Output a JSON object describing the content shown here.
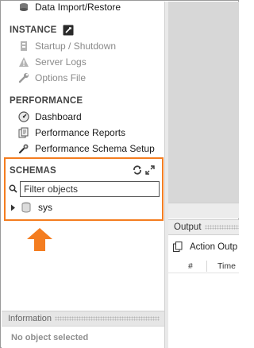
{
  "sidebar": {
    "data_import": "Data Import/Restore",
    "instance": {
      "title": "INSTANCE",
      "items": [
        {
          "label": "Startup / Shutdown",
          "icon": "startup-icon"
        },
        {
          "label": "Server Logs",
          "icon": "warning-icon"
        },
        {
          "label": "Options File",
          "icon": "wrench-icon"
        }
      ]
    },
    "performance": {
      "title": "PERFORMANCE",
      "items": [
        {
          "label": "Dashboard",
          "icon": "dashboard-icon"
        },
        {
          "label": "Performance Reports",
          "icon": "reports-icon"
        },
        {
          "label": "Performance Schema Setup",
          "icon": "schema-setup-icon"
        }
      ]
    },
    "schemas": {
      "title": "SCHEMAS",
      "filter_placeholder": "Filter objects",
      "tree": [
        {
          "label": "sys"
        }
      ]
    }
  },
  "information": {
    "title": "Information",
    "empty_text": "No object selected"
  },
  "output": {
    "title": "Output",
    "dropdown_label": "Action Outp",
    "columns": [
      "#",
      "Time"
    ]
  },
  "colors": {
    "highlight": "#f47d20",
    "editor_bg": "#d7d7d7"
  }
}
